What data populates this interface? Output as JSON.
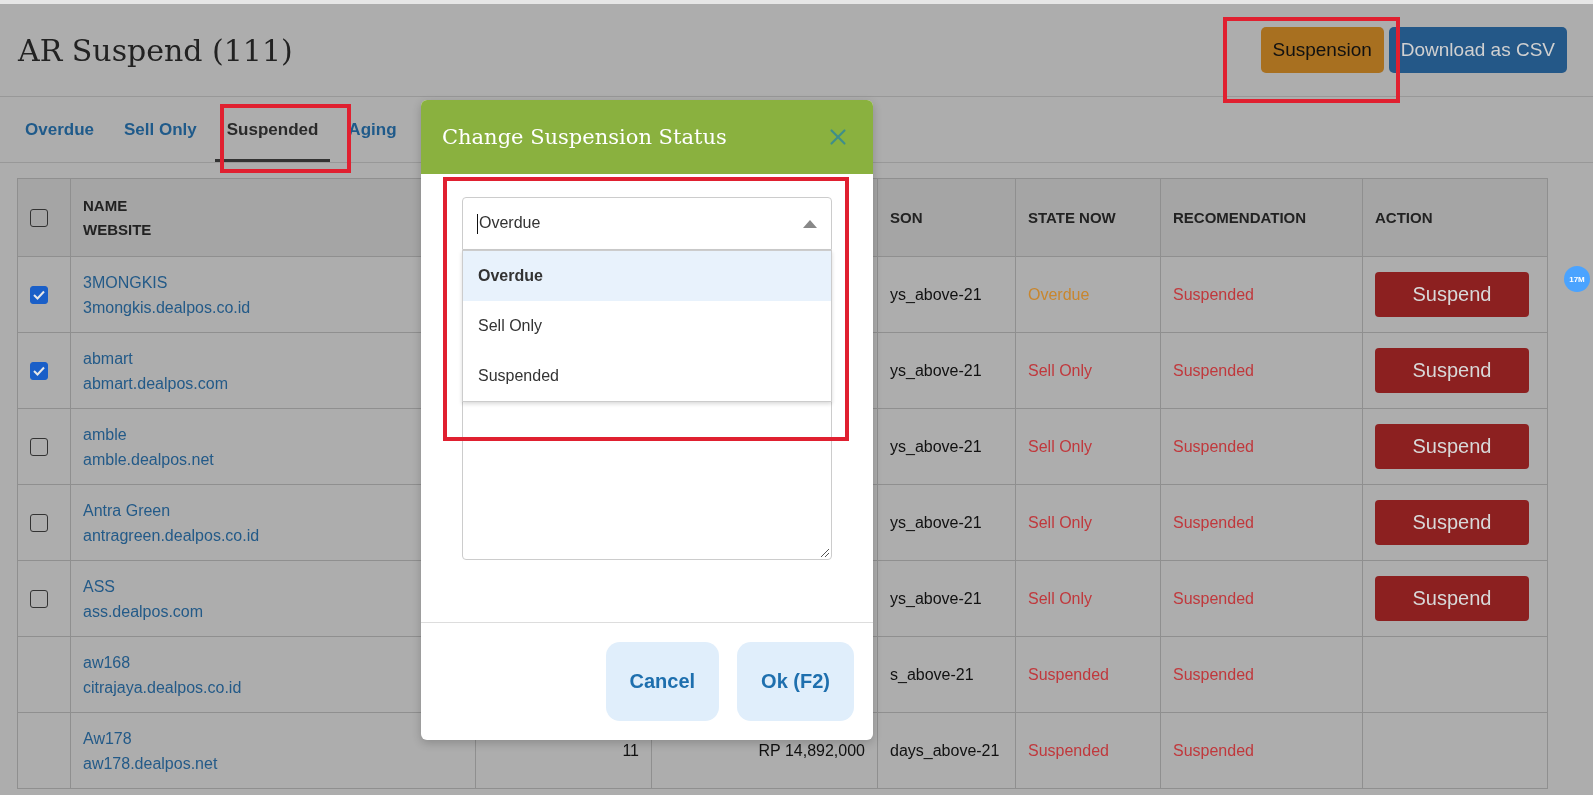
{
  "page": {
    "title": "AR Suspend (111)",
    "actions": [
      {
        "label": "Suspension",
        "kind": "warning"
      },
      {
        "label": "Download as CSV",
        "kind": "primary"
      }
    ]
  },
  "tabs": [
    {
      "label": "Overdue",
      "selected": false
    },
    {
      "label": "Sell Only",
      "selected": false
    },
    {
      "label": "Suspended",
      "selected": true
    },
    {
      "label": "Aging",
      "selected": false
    }
  ],
  "table": {
    "select_all": {
      "checked": false
    },
    "headings": {
      "name": "NAME",
      "website": "WEBSITE",
      "reason": "SON",
      "state": "STATE NOW",
      "recommendation": "RECOMENDATION",
      "action": "ACTION"
    },
    "rows": [
      {
        "checked": true,
        "name": "3MONGKIS",
        "website": "3mongkis.dealpos.co.id",
        "reason": "ys_above-21",
        "state": {
          "text": "Overdue",
          "color": "#c8862e"
        },
        "recommendation": "Suspended",
        "action": "Suspend"
      },
      {
        "checked": true,
        "name": "abmart",
        "website": "abmart.dealpos.com",
        "reason": "ys_above-21",
        "state": {
          "text": "Sell Only",
          "color": "#c0383c"
        },
        "recommendation": "Suspended",
        "action": "Suspend"
      },
      {
        "checked": false,
        "name": "amble",
        "website": "amble.dealpos.net",
        "reason": "ys_above-21",
        "state": {
          "text": "Sell Only",
          "color": "#c0383c"
        },
        "recommendation": "Suspended",
        "action": "Suspend"
      },
      {
        "checked": false,
        "name": "Antra Green",
        "website": "antragreen.dealpos.co.id",
        "reason": "ys_above-21",
        "state": {
          "text": "Sell Only",
          "color": "#c0383c"
        },
        "recommendation": "Suspended",
        "action": "Suspend"
      },
      {
        "checked": false,
        "name": "ASS",
        "website": "ass.dealpos.com",
        "reason": "ys_above-21",
        "state": {
          "text": "Sell Only",
          "color": "#c0383c"
        },
        "recommendation": "Suspended",
        "action": "Suspend"
      },
      {
        "name": "aw168",
        "website": "citrajaya.dealpos.co.id",
        "reason": "s_above-21",
        "state": {
          "text": "Suspended",
          "color": "#c0383c"
        },
        "recommendation": "Suspended"
      },
      {
        "name": "Aw178",
        "website": "aw178.dealpos.net",
        "count": "11",
        "amount": "RP 14,892,000",
        "reason": "days_above-21",
        "state": {
          "text": "Suspended",
          "color": "#c0383c"
        },
        "recommendation": "Suspended"
      }
    ]
  },
  "floating_badge": "17M",
  "modal": {
    "title": "Change Suspension Status",
    "select": {
      "value": "Overdue",
      "options": [
        {
          "label": "Overdue",
          "selected": true
        },
        {
          "label": "Sell Only",
          "selected": false
        },
        {
          "label": "Suspended",
          "selected": false
        }
      ]
    },
    "buttons": [
      "Cancel",
      "Ok (F2)"
    ]
  }
}
